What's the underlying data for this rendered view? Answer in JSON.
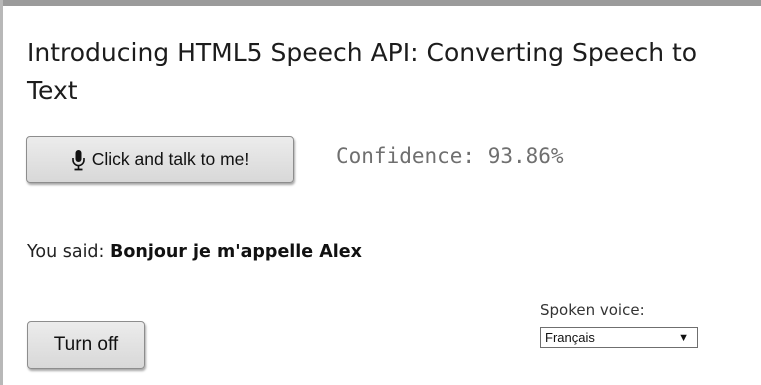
{
  "page": {
    "title": "Introducing HTML5 Speech API: Converting Speech to Text"
  },
  "recognition": {
    "talk_button_label": "Click and talk to me!",
    "talk_button_icon": "microphone-icon",
    "confidence_text": "Confidence: 93.86%",
    "confidence_percent": 93.86
  },
  "result": {
    "prefix": "You said: ",
    "transcript": "Bonjour je m'appelle Alex"
  },
  "synthesis": {
    "voice_label": "Spoken voice:",
    "voice_selected": "Français",
    "dropdown_icon": "triangle-down-icon",
    "off_button_label": "Turn off"
  },
  "colors": {
    "button_bg": "#dedede",
    "confidence_text": "#6f6f6f",
    "top_border": "#9b9b9b"
  }
}
